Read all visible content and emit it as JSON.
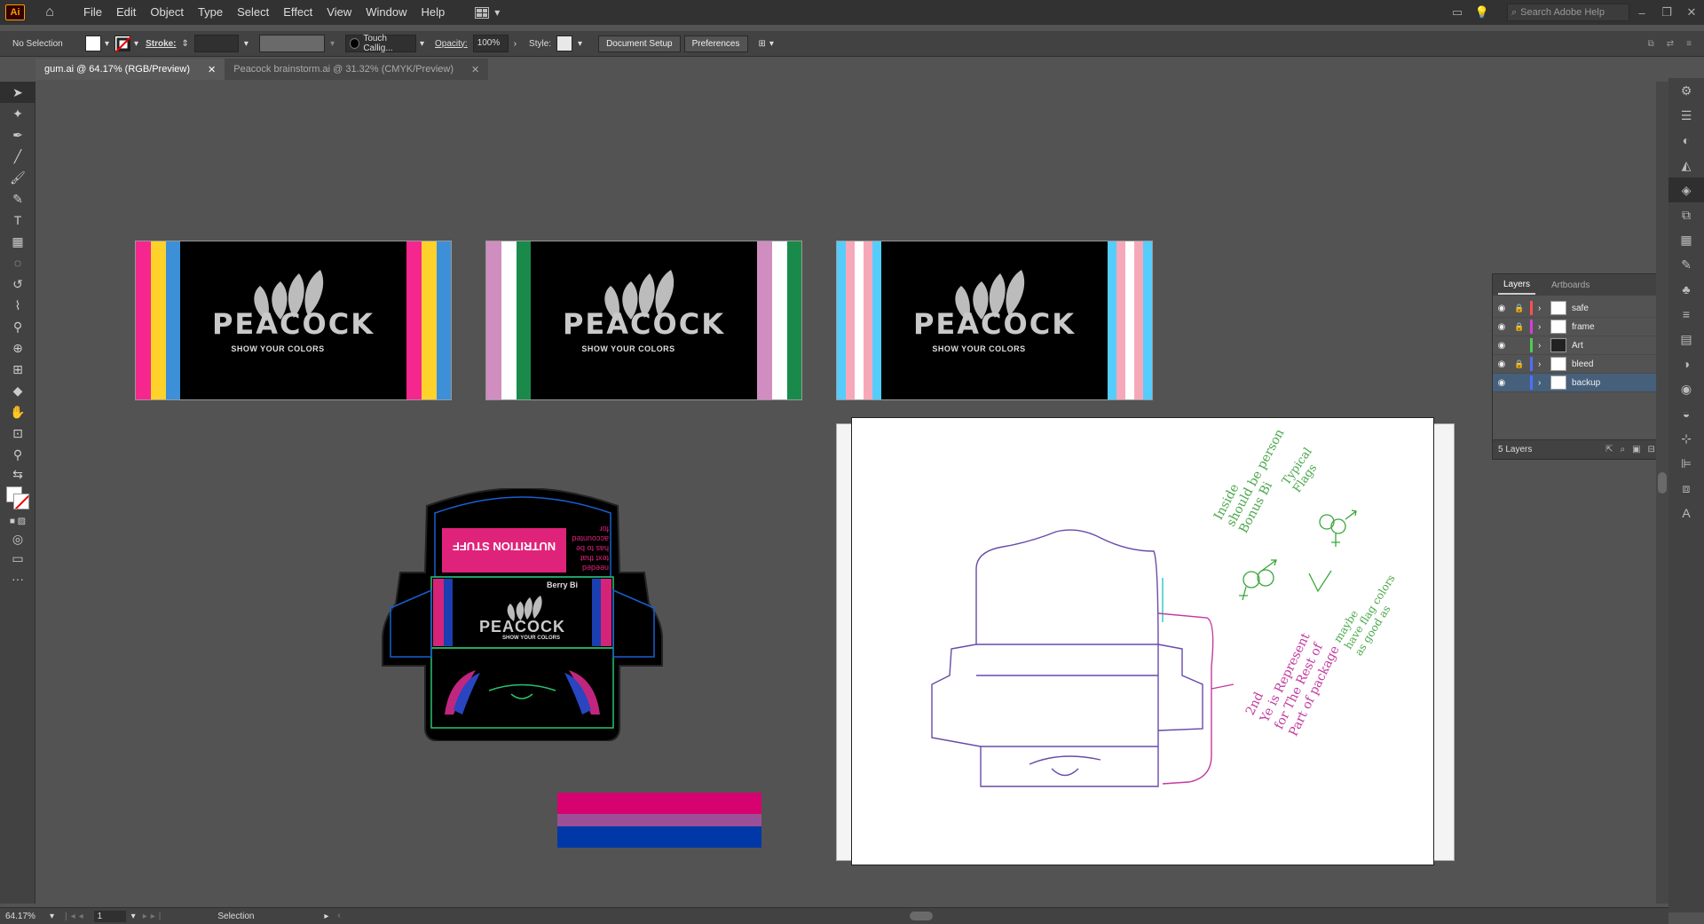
{
  "app": {
    "logo_text": "Ai"
  },
  "menu": [
    "File",
    "Edit",
    "Object",
    "Type",
    "Select",
    "Effect",
    "View",
    "Window",
    "Help"
  ],
  "search": {
    "placeholder": "Search Adobe Help"
  },
  "control": {
    "selection": "No Selection",
    "stroke_label": "Stroke:",
    "brush": "Touch Callig...",
    "opacity_label": "Opacity:",
    "opacity_value": "100%",
    "style_label": "Style:",
    "doc_setup": "Document Setup",
    "preferences": "Preferences"
  },
  "tabs": [
    {
      "label": "gum.ai @ 64.17% (RGB/Preview)",
      "active": true
    },
    {
      "label": "Peacock brainstorm.ai @ 31.32% (CMYK/Preview)",
      "active": false
    }
  ],
  "layers_panel": {
    "tabs": [
      "Layers",
      "Artboards"
    ],
    "layers": [
      {
        "name": "safe",
        "color": "#ff4f4f",
        "locked": true
      },
      {
        "name": "frame",
        "color": "#d33fd6",
        "locked": true
      },
      {
        "name": "Art",
        "color": "#4fcc4f",
        "locked": false
      },
      {
        "name": "bleed",
        "color": "#4f6fff",
        "locked": true
      },
      {
        "name": "backup",
        "color": "#4f6fff",
        "locked": false
      }
    ],
    "count": "5 Layers"
  },
  "artwork": {
    "brand": "PEACOCK",
    "tagline": "SHOW YOUR COLORS",
    "flavor": "Berry Bi",
    "nutrition": "NUTRITION STUFF",
    "needed_text": [
      "needed",
      "text that",
      "has to be",
      "accounted",
      "for"
    ],
    "flags": [
      {
        "name": "pan",
        "stripes": [
          "#f5268e",
          "#ffd22b",
          "#3d8fd8"
        ]
      },
      {
        "name": "aro",
        "stripes": [
          "#d08dc0",
          "#ffffff",
          "#1a8a4a"
        ]
      },
      {
        "name": "trans",
        "stripes": [
          "#55cdfc",
          "#f7a8b8",
          "#ffffff"
        ]
      }
    ],
    "bi_flag": [
      "#d60270",
      "#9b4f96",
      "#0038a8"
    ]
  },
  "sketch_notes": {
    "note1": [
      "Inside",
      "should be person",
      "Bonus Bi",
      "Typical",
      "Flags"
    ],
    "note2": [
      "maybe",
      "have flag colors",
      "as good as"
    ],
    "note3": [
      "2nd",
      "Ye is Represent",
      "for The Rest of",
      "Part of package"
    ]
  },
  "status": {
    "zoom": "64.17%",
    "artboard": "1",
    "tool": "Selection"
  }
}
